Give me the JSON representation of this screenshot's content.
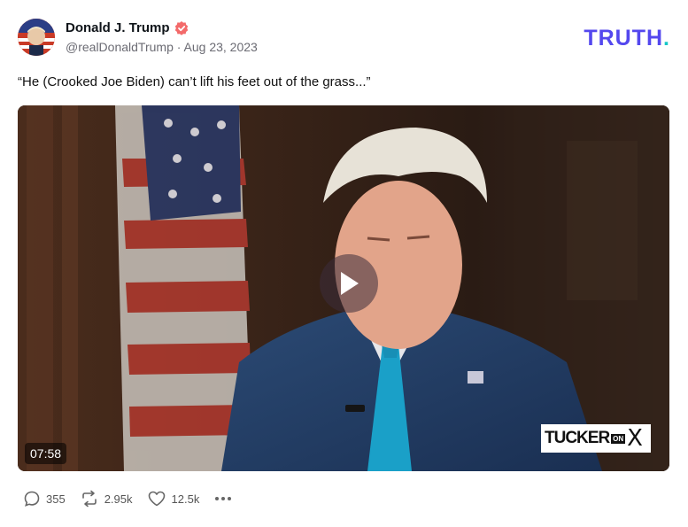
{
  "post": {
    "author": "Donald J. Trump",
    "handle_date": "@realDonaldTrump · Aug 23, 2023",
    "text": "“He (Crooked Joe Biden) can’t lift his feet out of the grass...”",
    "brand": {
      "main": "TRUTH",
      "dot": "."
    },
    "video": {
      "duration": "07:58",
      "watermark_main": "TUCKER",
      "watermark_on": "ON",
      "watermark_x": "X"
    },
    "actions": {
      "replies": "355",
      "retruths": "2.95k",
      "likes": "12.5k"
    }
  },
  "colors": {
    "brand": "#5448ee",
    "brand_dot": "#16c7c7",
    "verified": "#f36a6a"
  },
  "icons": [
    "avatar",
    "verified-icon",
    "play-icon",
    "reply-icon",
    "retruth-icon",
    "like-icon",
    "more-icon"
  ]
}
